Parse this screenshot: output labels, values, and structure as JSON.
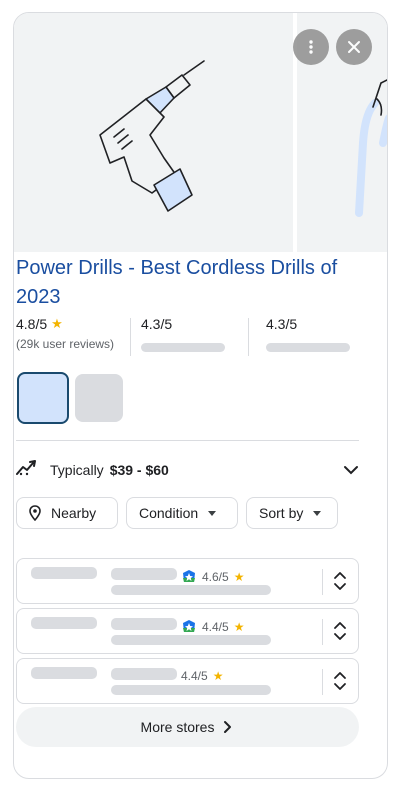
{
  "product": {
    "title": "Power Drills - Best Cordless Drills of 2023"
  },
  "ratings": [
    {
      "value": "4.8/5",
      "reviews": "(29k user reviews)"
    },
    {
      "value": "4.3/5"
    },
    {
      "value": "4.3/5"
    }
  ],
  "price": {
    "prefix": "Typically",
    "range": "$39 - $60"
  },
  "filters": {
    "nearby": "Nearby",
    "condition": "Condition",
    "sort": "Sort by"
  },
  "stores": [
    {
      "rating": "4.6/5",
      "has_badge": true
    },
    {
      "rating": "4.4/5",
      "has_badge": true
    },
    {
      "rating": "4.4/5",
      "has_badge": false
    }
  ],
  "more_stores": "More stores",
  "icons": {
    "more_options": "more-vert-icon",
    "close": "close-icon",
    "trend": "price-trend-icon",
    "location": "location-pin-icon",
    "expand": "chevron-down-icon",
    "store_expand": "unfold-icon",
    "next": "chevron-right-icon",
    "star": "star-icon"
  },
  "colors": {
    "title_link": "#1a4ea0",
    "star": "#f4b400",
    "accent_light": "#d2e3fc",
    "selected_border": "#1a4a6e",
    "placeholder": "#dadce0"
  }
}
